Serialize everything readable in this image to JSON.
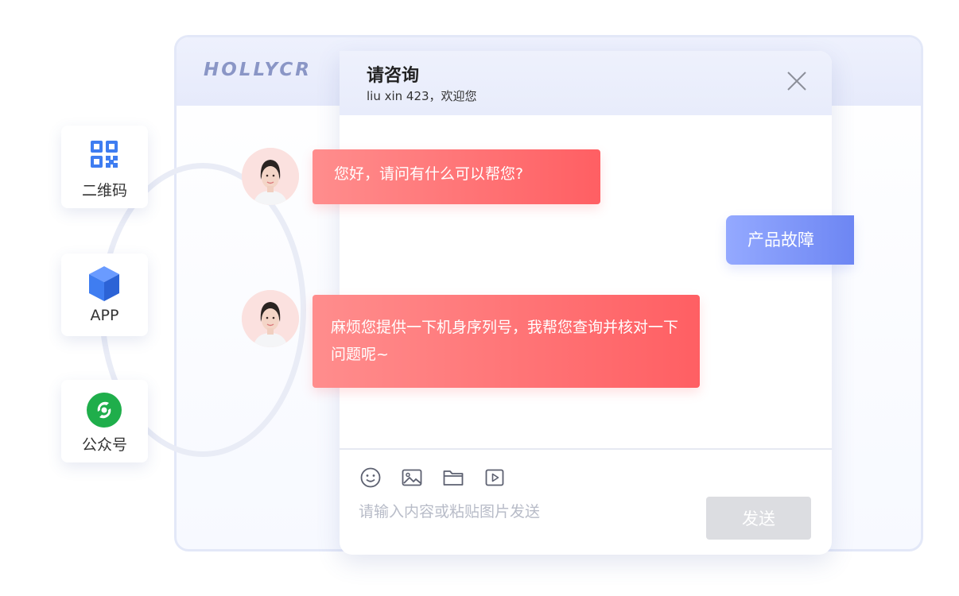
{
  "brand": "HOLLYCR",
  "channels": [
    {
      "label": "二维码",
      "icon": "qr-code-icon"
    },
    {
      "label": "APP",
      "icon": "cube-app-icon"
    },
    {
      "label": "公众号",
      "icon": "official-account-icon"
    }
  ],
  "chat": {
    "title": "请咨询",
    "subtitle": "liu xin 423，欢迎您",
    "close_icon": "close-icon",
    "messages": [
      {
        "from": "agent",
        "text": "您好，请问有什么可以帮您?"
      },
      {
        "from": "user",
        "text": "产品故障"
      },
      {
        "from": "agent",
        "text": "麻烦您提供一下机身序列号，我帮您查询并核对一下问题呢~"
      }
    ],
    "toolbar": [
      "emoji-icon",
      "image-icon",
      "folder-icon",
      "video-icon"
    ],
    "input_placeholder": "请输入内容或粘贴图片发送",
    "send_label": "发送"
  },
  "colors": {
    "agent_bubble": "#ff6f73",
    "user_bubble": "#7e96f8",
    "accent_blue": "#3f7df1",
    "wechat_green": "#1fae4b"
  }
}
